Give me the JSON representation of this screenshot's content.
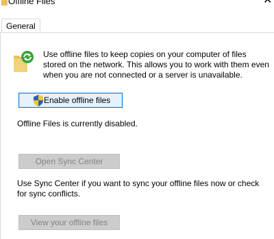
{
  "window": {
    "title": "Offline Files"
  },
  "tabs": [
    {
      "label": "General",
      "selected": true
    }
  ],
  "general": {
    "description": "Use offline files to keep copies on your computer of files stored on the network. This allows you to work with them even when you are not connected or a server is unavailable.",
    "enable_button_label": "Enable offline files",
    "status_text": "Offline Files is currently disabled.",
    "open_sync_center_label": "Open Sync Center",
    "sync_center_text": "Use Sync Center if you want to sync your offline files now or check for sync conflicts.",
    "view_files_label": "View your offline files"
  },
  "colors": {
    "accent": "#0078d7",
    "button_hover_bg": "#e5f1fb",
    "disabled_bg": "#cccccc",
    "disabled_text": "#838383",
    "folder": "#e8c15a",
    "sync_green": "#3aa33a"
  },
  "icons": {
    "title": "folder-icon",
    "close": "close-icon",
    "main": "offline-folder-sync-icon",
    "button": "uac-shield-icon"
  }
}
